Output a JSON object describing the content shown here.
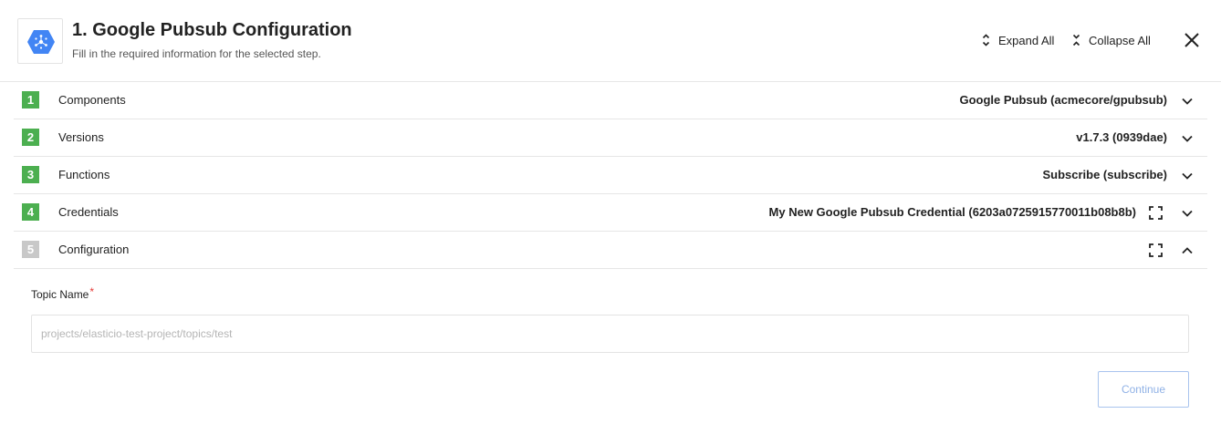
{
  "header": {
    "title": "1. Google Pubsub Configuration",
    "subtitle": "Fill in the required information for the selected step.",
    "logo_icon": "google-pubsub-icon",
    "expand_all": "Expand All",
    "collapse_all": "Collapse All",
    "close_icon": "close-icon"
  },
  "steps": [
    {
      "number": "1",
      "label": "Components",
      "value": "Google Pubsub (acmecore/gpubsub)",
      "status": "complete"
    },
    {
      "number": "2",
      "label": "Versions",
      "value": "v1.7.3 (0939dae)",
      "status": "complete"
    },
    {
      "number": "3",
      "label": "Functions",
      "value": "Subscribe (subscribe)",
      "status": "complete"
    },
    {
      "number": "4",
      "label": "Credentials",
      "value": "My New Google Pubsub Credential (6203a0725915770011b08b8b)",
      "status": "complete"
    },
    {
      "number": "5",
      "label": "Configuration",
      "value": "",
      "status": "active"
    }
  ],
  "form": {
    "topic_label": "Topic Name",
    "required_mark": "*",
    "topic_placeholder": "projects/elasticio-test-project/topics/test",
    "topic_value": ""
  },
  "continue_label": "Continue",
  "colors": {
    "step_complete": "#4caf50",
    "step_pending": "#c8c8c8",
    "pubsub_blue": "#4285f4",
    "required": "#e53935",
    "continue_border": "#a9c4ee"
  }
}
